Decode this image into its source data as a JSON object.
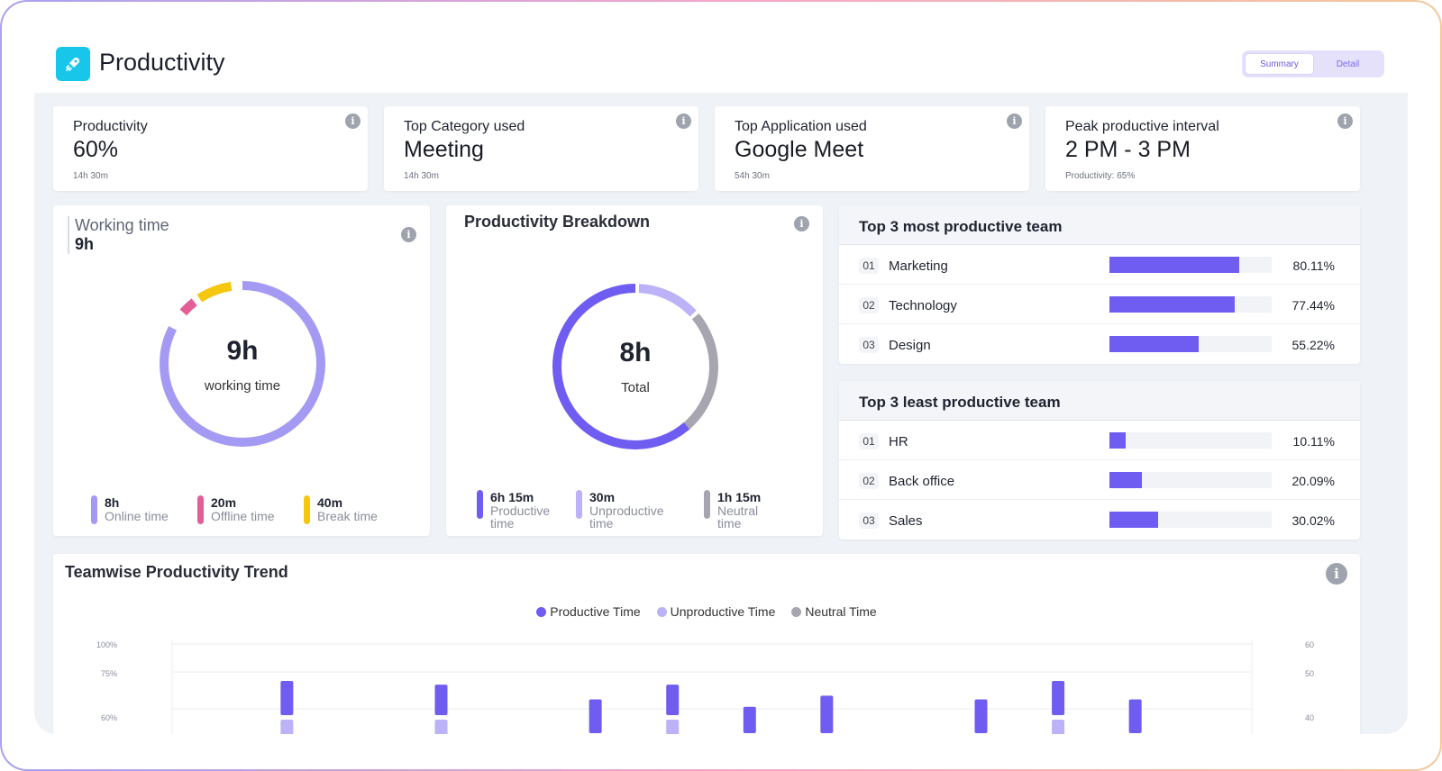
{
  "header": {
    "title": "Productivity",
    "icon": "rocket-icon",
    "toggle": [
      "Summary",
      "Detail"
    ],
    "active_toggle": "Summary"
  },
  "kpis": [
    {
      "label": "Productivity",
      "value": "60%",
      "sub": "14h 30m"
    },
    {
      "label": "Top Category used",
      "value": "Meeting",
      "sub": "14h 30m"
    },
    {
      "label": "Top Application used",
      "value": "Google Meet",
      "sub": "54h 30m"
    },
    {
      "label": "Peak productive interval",
      "value": "2 PM - 3 PM",
      "sub": "Productivity: 65%"
    }
  ],
  "working_time": {
    "title": "Working time",
    "value": "9h",
    "center_value": "9h",
    "center_label": "working time",
    "legend": [
      {
        "value": "8h",
        "label": "Online time",
        "color": "#a59af3"
      },
      {
        "value": "20m",
        "label": "Offline time",
        "color": "#e35d97"
      },
      {
        "value": "40m",
        "label": "Break time",
        "color": "#f5c70f"
      }
    ]
  },
  "breakdown": {
    "title": "Productivity Breakdown",
    "center_value": "8h",
    "center_label": "Total",
    "legend": [
      {
        "value": "6h 15m",
        "label_line1": "Productive",
        "label_line2": "time",
        "color": "#6f5cf1"
      },
      {
        "value": "30m",
        "label_line1": "Unproductive",
        "label_line2": "time",
        "color": "#bcb2f7"
      },
      {
        "value": "1h 15m",
        "label_line1": "Neutral",
        "label_line2": "time",
        "color": "#a7a6b0"
      }
    ]
  },
  "most_productive": {
    "title": "Top 3 most productive team",
    "rows": [
      {
        "num": "01",
        "name": "Marketing",
        "pct": "80.11%",
        "value": 80.11
      },
      {
        "num": "02",
        "name": "Technology",
        "pct": "77.44%",
        "value": 77.44
      },
      {
        "num": "03",
        "name": "Design",
        "pct": "55.22%",
        "value": 55.22
      }
    ]
  },
  "least_productive": {
    "title": "Top 3 least productive team",
    "rows": [
      {
        "num": "01",
        "name": "HR",
        "pct": "10.11%",
        "value": 10.11
      },
      {
        "num": "02",
        "name": "Back office",
        "pct": "20.09%",
        "value": 20.09
      },
      {
        "num": "03",
        "name": "Sales",
        "pct": "30.02%",
        "value": 30.02
      }
    ]
  },
  "trend": {
    "title": "Teamwise Productivity Trend",
    "legend": [
      {
        "label": "Productive Time",
        "color": "#6f5cf1"
      },
      {
        "label": "Unproductive Time",
        "color": "#bcb2f7"
      },
      {
        "label": "Neutral Time",
        "color": "#a7a6b0"
      }
    ],
    "left_ticks": [
      "100%",
      "75%",
      "60%"
    ],
    "right_ticks": [
      "60",
      "50",
      "40"
    ]
  },
  "chart_data": {
    "type": "bar",
    "left_axis_ticks": [
      "100%",
      "75%",
      "60%"
    ],
    "right_axis_ticks": [
      60,
      50,
      40
    ],
    "series": [
      {
        "name": "Productive Time",
        "values": [
          0,
          50,
          0,
          49,
          0,
          45,
          49,
          43,
          46,
          0,
          45,
          50,
          45,
          0
        ]
      },
      {
        "name": "Unproductive Time",
        "values": [
          0,
          40,
          0,
          42,
          0,
          0,
          42,
          0,
          0,
          0,
          0,
          42,
          0,
          0
        ]
      }
    ],
    "legend": "top-center",
    "grid": true
  }
}
